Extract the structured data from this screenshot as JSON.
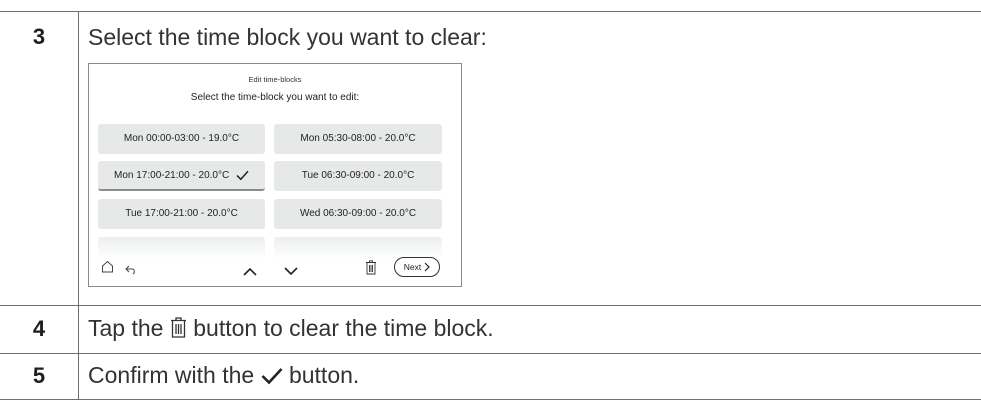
{
  "steps": [
    {
      "number": "3",
      "text": "Select the time block you want to clear:"
    },
    {
      "number": "4",
      "text_before": "Tap the",
      "text_after": "button to clear the time block.",
      "icon": "trash-icon"
    },
    {
      "number": "5",
      "text_before": "Confirm with the",
      "text_after": "button.",
      "icon": "checkmark-icon"
    }
  ],
  "screen": {
    "title": "Edit time-blocks",
    "subtitle": "Select the time-block you want to edit:",
    "blocks": [
      {
        "label": "Mon 00:00-03:00 - 19.0°C",
        "selected": false
      },
      {
        "label": "Mon 05:30-08:00 - 20.0°C",
        "selected": false
      },
      {
        "label": "Mon 17:00-21:00 - 20.0°C",
        "selected": true
      },
      {
        "label": "Tue 06:30-09:00 - 20.0°C",
        "selected": false
      },
      {
        "label": "Tue 17:00-21:00 - 20.0°C",
        "selected": false
      },
      {
        "label": "Wed 06:30-09:00 - 20.0°C",
        "selected": false
      }
    ],
    "icons": [
      "home-icon",
      "back-icon",
      "chevron-up-icon",
      "chevron-down-icon",
      "trash-icon",
      "chevron-right-icon"
    ],
    "next_label": "Next"
  }
}
